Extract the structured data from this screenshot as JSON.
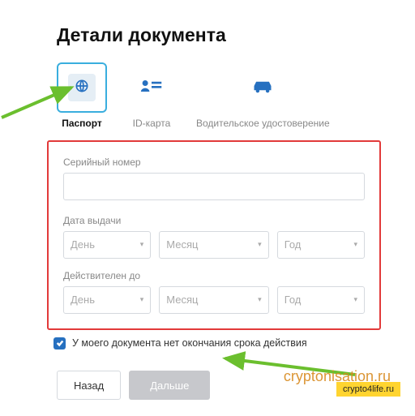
{
  "heading": "Детали документа",
  "doc_types": {
    "passport": "Паспорт",
    "id_card": "ID-карта",
    "driver": "Водительское удостоверение"
  },
  "form": {
    "serial_label": "Серийный номер",
    "issue_label": "Дата выдачи",
    "expiry_label": "Действителен до",
    "day": "День",
    "month": "Месяц",
    "year": "Год"
  },
  "checkbox_label": "У моего документа нет окончания срока действия",
  "buttons": {
    "back": "Назад",
    "next": "Дальше"
  },
  "watermark": "cryptonisation.ru",
  "badge": "crypto4life.ru"
}
